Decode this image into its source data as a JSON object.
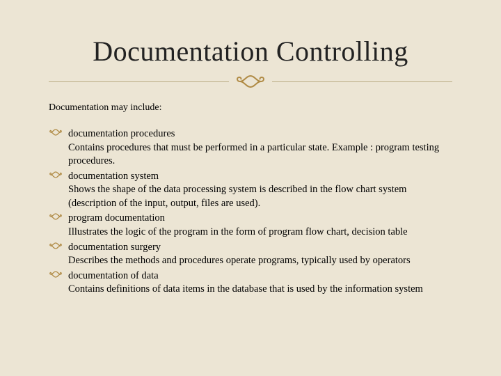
{
  "colors": {
    "background": "#ece5d4",
    "accent": "#b08b45",
    "rule": "#b8aa82",
    "text": "#000000"
  },
  "title": "Documentation Controlling",
  "subheading": "Documentation may include:",
  "items": [
    {
      "heading": "documentation procedures",
      "body": "Contains procedures that must be performed in a particular state. Example : program testing procedures."
    },
    {
      "heading": "documentation system",
      "body": "Shows the shape of the data processing system is described in the flow chart system (description of the input, output, files are used)."
    },
    {
      "heading": "program documentation",
      "body": "Illustrates the logic of the program in the form of program flow chart, decision table"
    },
    {
      "heading": "documentation surgery",
      "body": "Describes the methods and procedures operate programs, typically used by operators"
    },
    {
      "heading": "documentation of data",
      "body": "Contains definitions of data items in the database that is used by the information system"
    }
  ]
}
